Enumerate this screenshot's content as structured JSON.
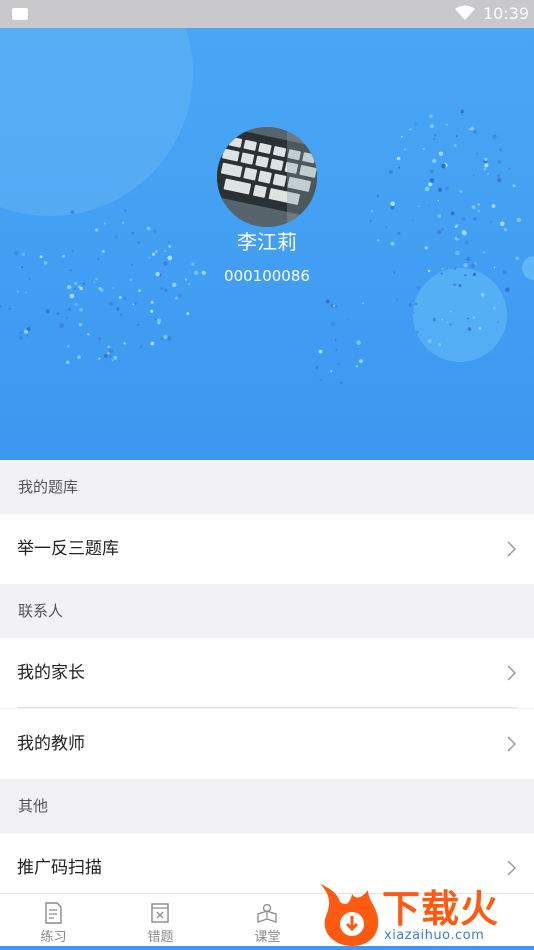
{
  "status_bar": {
    "time": "10:39"
  },
  "profile": {
    "name": "李江莉",
    "id": "000100086"
  },
  "sections": [
    {
      "title": "我的题库",
      "items": [
        {
          "label": "举一反三题库"
        }
      ]
    },
    {
      "title": "联系人",
      "items": [
        {
          "label": "我的家长"
        },
        {
          "label": "我的教师"
        }
      ]
    },
    {
      "title": "其他",
      "items": [
        {
          "label": "推广码扫描"
        }
      ]
    }
  ],
  "bottom_nav": [
    {
      "label": "练习",
      "icon": "document-icon"
    },
    {
      "label": "错题",
      "icon": "wrong-question-icon"
    },
    {
      "label": "课堂",
      "icon": "classroom-icon"
    }
  ],
  "watermark": {
    "brand": "下载火",
    "url": "xiazaihuo.com"
  },
  "colors": {
    "header_blue": "#3c98f0",
    "accent_orange": "#ff5a12"
  }
}
